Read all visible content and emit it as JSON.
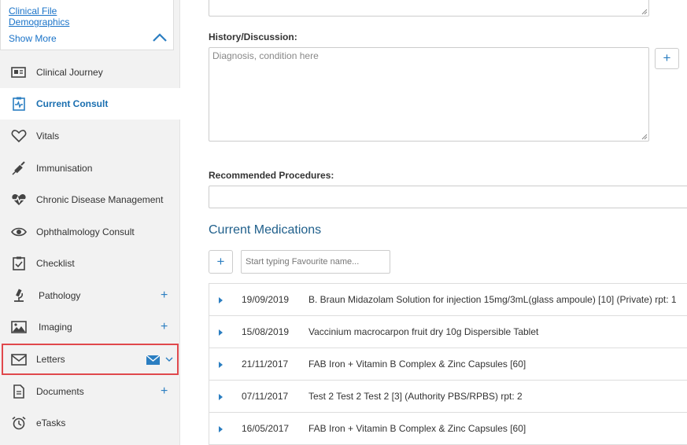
{
  "sidebar": {
    "top_links": [
      "Clinical File",
      "Demographics"
    ],
    "show_more": "Show More",
    "items": [
      {
        "label": "Clinical Journey",
        "icon": "newspaper-icon"
      },
      {
        "label": "Current Consult",
        "icon": "clipboard-pulse-icon",
        "active": true
      },
      {
        "label": "Vitals",
        "icon": "heart-icon"
      },
      {
        "label": "Immunisation",
        "icon": "syringe-icon"
      },
      {
        "label": "Chronic Disease Management",
        "icon": "heartbeat-icon"
      },
      {
        "label": "Ophthalmology Consult",
        "icon": "eye-icon"
      },
      {
        "label": "Checklist",
        "icon": "checklist-icon"
      },
      {
        "label": "Pathology",
        "icon": "microscope-icon",
        "add": true
      },
      {
        "label": "Imaging",
        "icon": "image-icon",
        "add": true
      },
      {
        "label": "Letters",
        "icon": "envelope-icon",
        "highlighted": true
      },
      {
        "label": "Documents",
        "icon": "document-icon",
        "add": true
      },
      {
        "label": "eTasks",
        "icon": "alarm-clock-icon"
      }
    ]
  },
  "main": {
    "history_label": "History/Discussion:",
    "history_placeholder": "Diagnosis, condition here",
    "recommended_label": "Recommended Procedures:",
    "medications_title": "Current Medications",
    "favourite_placeholder": "Start typing Favourite name...",
    "medications": [
      {
        "date": "19/09/2019",
        "desc": "B. Braun Midazolam Solution for injection 15mg/3mL(glass ampoule) [10] (Private) rpt: 1"
      },
      {
        "date": "15/08/2019",
        "desc": "Vaccinium macrocarpon fruit dry 10g Dispersible Tablet"
      },
      {
        "date": "21/11/2017",
        "desc": "FAB Iron + Vitamin B Complex & Zinc Capsules [60]"
      },
      {
        "date": "07/11/2017",
        "desc": "Test 2 Test 2 Test 2 [3] (Authority PBS/RPBS) rpt: 2"
      },
      {
        "date": "16/05/2017",
        "desc": "FAB Iron + Vitamin B Complex & Zinc Capsules [60]"
      }
    ]
  },
  "colors": {
    "accent": "#2b7ec1",
    "highlight_border": "#e0484c",
    "title": "#1f5f8b"
  }
}
